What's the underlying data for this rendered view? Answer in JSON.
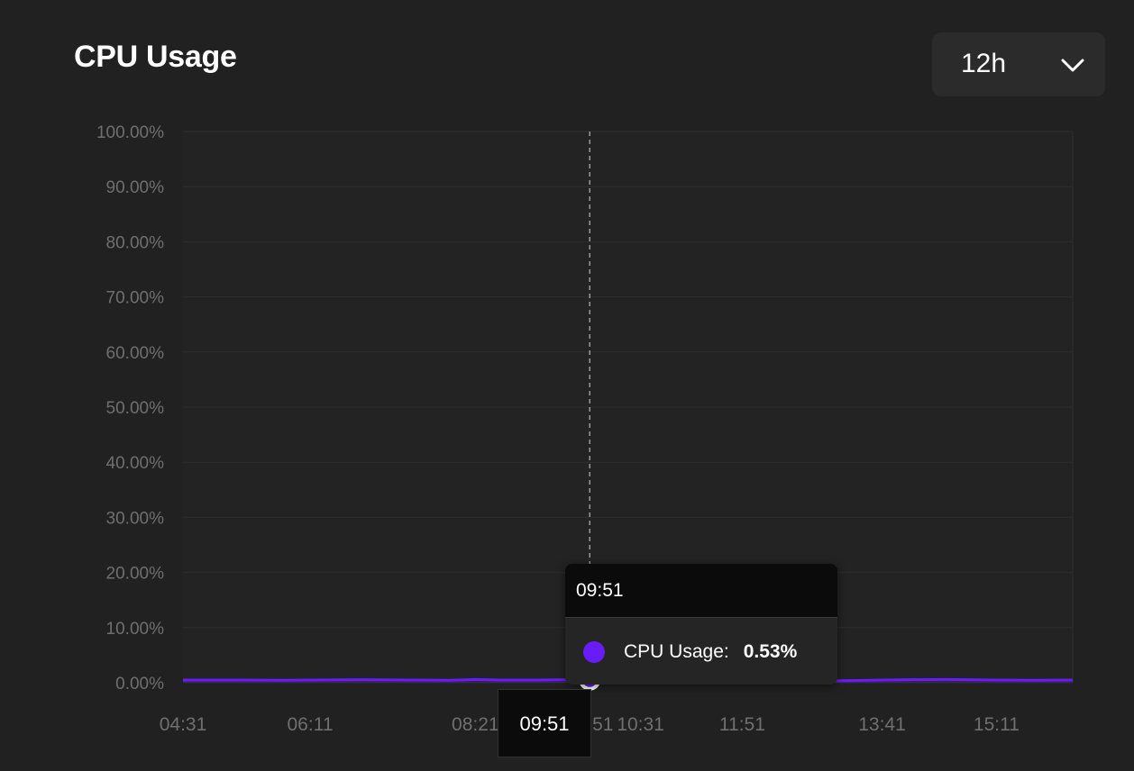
{
  "header": {
    "title": "CPU Usage"
  },
  "range_select": {
    "value": "12h"
  },
  "colors": {
    "series": "#6a1cf6",
    "background": "#212121",
    "grid": "#2e2e2e",
    "tooltip_header": "#0b0b0b"
  },
  "icons": {
    "dropdown": "chevron-down-icon"
  },
  "tooltip": {
    "time": "09:51",
    "series_label": "CPU Usage:",
    "value": "0.53%"
  },
  "cursor_label": "09:51",
  "chart_data": {
    "type": "area",
    "title": "CPU Usage",
    "y_ticks": [
      "100.00%",
      "90.00%",
      "80.00%",
      "70.00%",
      "60.00%",
      "50.00%",
      "40.00%",
      "30.00%",
      "20.00%",
      "10.00%",
      "0.00%"
    ],
    "x_ticks": [
      "04:31",
      "06:11",
      "08:21",
      "09:51",
      "10:31",
      "11:51",
      "13:41",
      "15:11"
    ],
    "ylim": [
      0,
      100
    ],
    "grid": true,
    "series": [
      {
        "name": "CPU Usage",
        "color": "#6a1cf6",
        "x": [
          "04:31",
          "05:11",
          "05:51",
          "06:11",
          "06:51",
          "07:31",
          "08:01",
          "08:21",
          "08:41",
          "09:11",
          "09:31",
          "09:51",
          "10:11",
          "10:31",
          "11:01",
          "11:31",
          "11:51",
          "12:21",
          "12:51",
          "13:21",
          "13:41",
          "14:01",
          "14:31",
          "15:11",
          "15:41",
          "16:11"
        ],
        "values": [
          0.5,
          0.5,
          0.45,
          0.5,
          0.55,
          0.5,
          0.45,
          0.6,
          0.5,
          0.5,
          0.55,
          0.53,
          0.45,
          0.35,
          0.3,
          0.35,
          0.3,
          0.25,
          0.3,
          0.4,
          0.5,
          0.55,
          0.6,
          0.5,
          0.45,
          0.5
        ]
      }
    ],
    "highlight": {
      "x": "09:51",
      "value": 0.53
    }
  }
}
